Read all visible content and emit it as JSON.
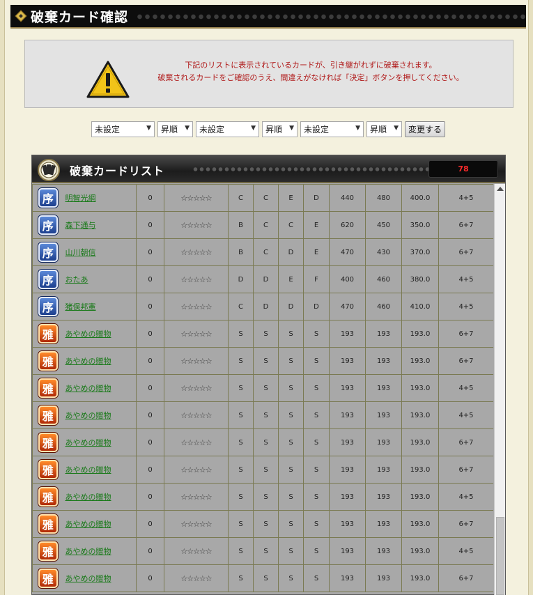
{
  "page": {
    "title": "破棄カード確認"
  },
  "notice": {
    "line1": "下記のリストに表示されているカードが、引き継がれずに破棄されます。",
    "line2": "破棄されるカードをご確認のうえ、間違えがなければ「決定」ボタンを押してください。"
  },
  "filters": {
    "sort1": "未設定",
    "order1": "昇順",
    "sort2": "未設定",
    "order2": "昇順",
    "sort3": "未設定",
    "order3": "昇順",
    "change_button": "変更する"
  },
  "list": {
    "title": "破棄カードリスト",
    "count": "78",
    "rows": [
      {
        "rarity": "序",
        "name": "明智光綱",
        "level": "0",
        "stars": "☆☆☆☆☆",
        "r1": "C",
        "r2": "C",
        "r3": "E",
        "r4": "D",
        "v1": "440",
        "v2": "480",
        "v3": "400.0",
        "cost": "4+5"
      },
      {
        "rarity": "序",
        "name": "森下通与",
        "level": "0",
        "stars": "☆☆☆☆☆",
        "r1": "B",
        "r2": "C",
        "r3": "C",
        "r4": "E",
        "v1": "620",
        "v2": "450",
        "v3": "350.0",
        "cost": "6+7"
      },
      {
        "rarity": "序",
        "name": "山川朝信",
        "level": "0",
        "stars": "☆☆☆☆☆",
        "r1": "B",
        "r2": "C",
        "r3": "D",
        "r4": "E",
        "v1": "470",
        "v2": "430",
        "v3": "370.0",
        "cost": "6+7"
      },
      {
        "rarity": "序",
        "name": "おたあ",
        "level": "0",
        "stars": "☆☆☆☆☆",
        "r1": "D",
        "r2": "D",
        "r3": "E",
        "r4": "F",
        "v1": "400",
        "v2": "460",
        "v3": "380.0",
        "cost": "4+5"
      },
      {
        "rarity": "序",
        "name": "猪俣邦憲",
        "level": "0",
        "stars": "☆☆☆☆☆",
        "r1": "C",
        "r2": "D",
        "r3": "D",
        "r4": "D",
        "v1": "470",
        "v2": "460",
        "v3": "410.0",
        "cost": "4+5"
      },
      {
        "rarity": "雅",
        "name": "あやめの贈物",
        "level": "0",
        "stars": "☆☆☆☆☆",
        "r1": "S",
        "r2": "S",
        "r3": "S",
        "r4": "S",
        "v1": "193",
        "v2": "193",
        "v3": "193.0",
        "cost": "6+7"
      },
      {
        "rarity": "雅",
        "name": "あやめの贈物",
        "level": "0",
        "stars": "☆☆☆☆☆",
        "r1": "S",
        "r2": "S",
        "r3": "S",
        "r4": "S",
        "v1": "193",
        "v2": "193",
        "v3": "193.0",
        "cost": "6+7"
      },
      {
        "rarity": "雅",
        "name": "あやめの贈物",
        "level": "0",
        "stars": "☆☆☆☆☆",
        "r1": "S",
        "r2": "S",
        "r3": "S",
        "r4": "S",
        "v1": "193",
        "v2": "193",
        "v3": "193.0",
        "cost": "4+5"
      },
      {
        "rarity": "雅",
        "name": "あやめの贈物",
        "level": "0",
        "stars": "☆☆☆☆☆",
        "r1": "S",
        "r2": "S",
        "r3": "S",
        "r4": "S",
        "v1": "193",
        "v2": "193",
        "v3": "193.0",
        "cost": "4+5"
      },
      {
        "rarity": "雅",
        "name": "あやめの贈物",
        "level": "0",
        "stars": "☆☆☆☆☆",
        "r1": "S",
        "r2": "S",
        "r3": "S",
        "r4": "S",
        "v1": "193",
        "v2": "193",
        "v3": "193.0",
        "cost": "6+7"
      },
      {
        "rarity": "雅",
        "name": "あやめの贈物",
        "level": "0",
        "stars": "☆☆☆☆☆",
        "r1": "S",
        "r2": "S",
        "r3": "S",
        "r4": "S",
        "v1": "193",
        "v2": "193",
        "v3": "193.0",
        "cost": "6+7"
      },
      {
        "rarity": "雅",
        "name": "あやめの贈物",
        "level": "0",
        "stars": "☆☆☆☆☆",
        "r1": "S",
        "r2": "S",
        "r3": "S",
        "r4": "S",
        "v1": "193",
        "v2": "193",
        "v3": "193.0",
        "cost": "4+5"
      },
      {
        "rarity": "雅",
        "name": "あやめの贈物",
        "level": "0",
        "stars": "☆☆☆☆☆",
        "r1": "S",
        "r2": "S",
        "r3": "S",
        "r4": "S",
        "v1": "193",
        "v2": "193",
        "v3": "193.0",
        "cost": "6+7"
      },
      {
        "rarity": "雅",
        "name": "あやめの贈物",
        "level": "0",
        "stars": "☆☆☆☆☆",
        "r1": "S",
        "r2": "S",
        "r3": "S",
        "r4": "S",
        "v1": "193",
        "v2": "193",
        "v3": "193.0",
        "cost": "4+5"
      },
      {
        "rarity": "雅",
        "name": "あやめの贈物",
        "level": "0",
        "stars": "☆☆☆☆☆",
        "r1": "S",
        "r2": "S",
        "r3": "S",
        "r4": "S",
        "v1": "193",
        "v2": "193",
        "v3": "193.0",
        "cost": "6+7"
      }
    ]
  },
  "colors": {
    "title_bar_bg": "#0d0d0d",
    "notice_text": "#b01818",
    "name_link": "#1a7a1a",
    "count_text": "#ff2a2a",
    "table_bg": "#a8a8a8",
    "badge_jo": "#2a56b8",
    "badge_ga": "#e0541a"
  },
  "icons": {
    "title": "gold-diamond-icon",
    "warning": "warning-triangle-icon",
    "list": "card-emblem-icon",
    "scroll": "scroll-up-arrow-icon"
  }
}
